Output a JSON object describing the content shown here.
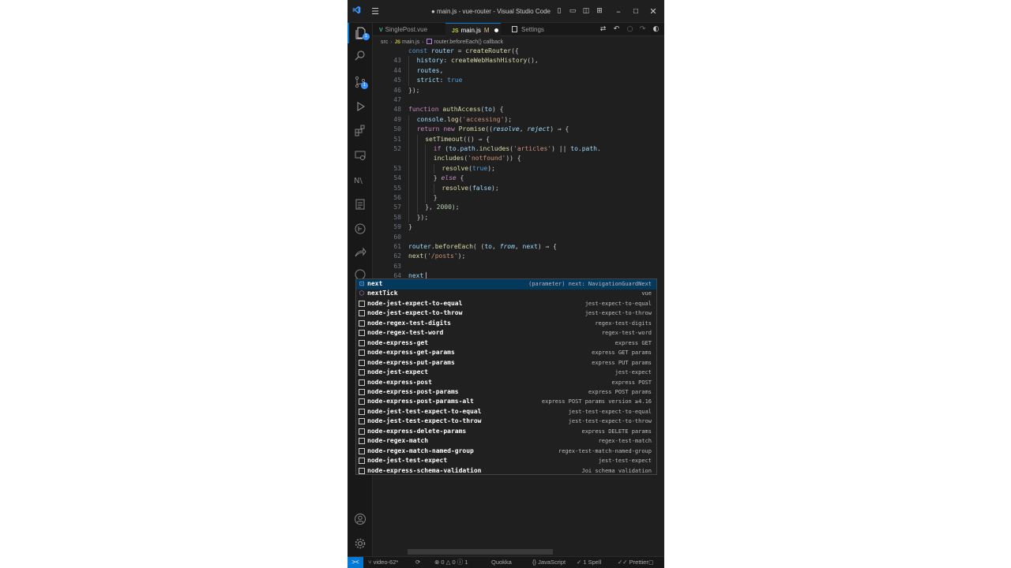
{
  "window": {
    "title": "● main.js - vue-router - Visual Studio Code"
  },
  "tabs": [
    {
      "lang": "V",
      "name": "SinglePost.vue"
    },
    {
      "lang": "JS",
      "name": "main.js",
      "modified": "M"
    },
    {
      "lang": "",
      "name": "Settings"
    }
  ],
  "breadcrumb": {
    "folder": "src",
    "file_lang": "JS",
    "file": "main.js",
    "symbol": "router.beforeEach() callback"
  },
  "editor": {
    "lines": [
      {
        "n": "",
        "text": "const router = createRouter({"
      },
      {
        "n": "43",
        "text": "history: createWebHashHistory(),"
      },
      {
        "n": "44",
        "text": "routes,"
      },
      {
        "n": "45",
        "text": "strict: true"
      },
      {
        "n": "46",
        "text": "});"
      },
      {
        "n": "47",
        "text": ""
      },
      {
        "n": "48",
        "text": "function authAccess(to) {"
      },
      {
        "n": "49",
        "text": "console.log('accessing');"
      },
      {
        "n": "50",
        "text": "return new Promise((resolve, reject) => {"
      },
      {
        "n": "51",
        "text": "setTimeout(() => {"
      },
      {
        "n": "52",
        "text": "if (to.path.includes('articles') || to.path."
      },
      {
        "n": "",
        "text": "includes('notfound')) {"
      },
      {
        "n": "53",
        "text": "resolve(true);"
      },
      {
        "n": "54",
        "text": "} else {"
      },
      {
        "n": "55",
        "text": "resolve(false);"
      },
      {
        "n": "56",
        "text": "}"
      },
      {
        "n": "57",
        "text": "}, 2000);"
      },
      {
        "n": "58",
        "text": "});"
      },
      {
        "n": "59",
        "text": "}"
      },
      {
        "n": "60",
        "text": ""
      },
      {
        "n": "61",
        "text": "router.beforeEach( (to, from, next) => {"
      },
      {
        "n": "62",
        "text": "next('/posts');"
      },
      {
        "n": "63",
        "text": ""
      },
      {
        "n": "64",
        "text": "next"
      }
    ]
  },
  "suggest": {
    "items": [
      {
        "label": "next",
        "detail": "(parameter) next: NavigationGuardNext",
        "icon": "variable-icon",
        "selected": true
      },
      {
        "label": "nextTick",
        "detail": "vue",
        "icon": "function-icon"
      },
      {
        "label": "node-jest-expect-to-equal",
        "detail": "jest-expect-to-equal",
        "icon": "snippet-icon"
      },
      {
        "label": "node-jest-expect-to-throw",
        "detail": "jest-expect-to-throw",
        "icon": "snippet-icon"
      },
      {
        "label": "node-regex-test-digits",
        "detail": "regex-test-digits",
        "icon": "snippet-icon"
      },
      {
        "label": "node-regex-test-word",
        "detail": "regex-test-word",
        "icon": "snippet-icon"
      },
      {
        "label": "node-express-get",
        "detail": "express GET",
        "icon": "snippet-icon"
      },
      {
        "label": "node-express-get-params",
        "detail": "express GET params",
        "icon": "snippet-icon"
      },
      {
        "label": "node-express-put-params",
        "detail": "express PUT params",
        "icon": "snippet-icon"
      },
      {
        "label": "node-jest-expect",
        "detail": "jest-expect",
        "icon": "snippet-icon"
      },
      {
        "label": "node-express-post",
        "detail": "express POST",
        "icon": "snippet-icon"
      },
      {
        "label": "node-express-post-params",
        "detail": "express POST params",
        "icon": "snippet-icon"
      },
      {
        "label": "node-express-post-params-alt",
        "detail": "express POST params version ≥4.16",
        "icon": "snippet-icon"
      },
      {
        "label": "node-jest-test-expect-to-equal",
        "detail": "jest-test-expect-to-equal",
        "icon": "snippet-icon"
      },
      {
        "label": "node-jest-test-expect-to-throw",
        "detail": "jest-test-expect-to-throw",
        "icon": "snippet-icon"
      },
      {
        "label": "node-express-delete-params",
        "detail": "express DELETE params",
        "icon": "snippet-icon"
      },
      {
        "label": "node-regex-match",
        "detail": "regex-test-match",
        "icon": "snippet-icon"
      },
      {
        "label": "node-regex-match-named-group",
        "detail": "regex-test-match-named-group",
        "icon": "snippet-icon"
      },
      {
        "label": "node-jest-test-expect",
        "detail": "jest-test-expect",
        "icon": "snippet-icon"
      },
      {
        "label": "node-express-schema-validation",
        "detail": "Joi schema validation",
        "icon": "snippet-icon"
      }
    ]
  },
  "activity": {
    "badges": {
      "explorer": "1",
      "scm": "1"
    }
  },
  "status": {
    "remote": "><",
    "branch": "video-62*",
    "errors": "0",
    "warnings": "0",
    "info": "1",
    "quokka": "Quokka",
    "language": "JavaScript",
    "spell": "1 Spell",
    "prettier": "Prettier"
  },
  "colors": {
    "accent": "#0078d4",
    "editor_bg": "#1f1f1f",
    "selection": "#04395e",
    "keyword": "#c586c0",
    "function": "#dcdcaa",
    "string": "#ce9178"
  }
}
